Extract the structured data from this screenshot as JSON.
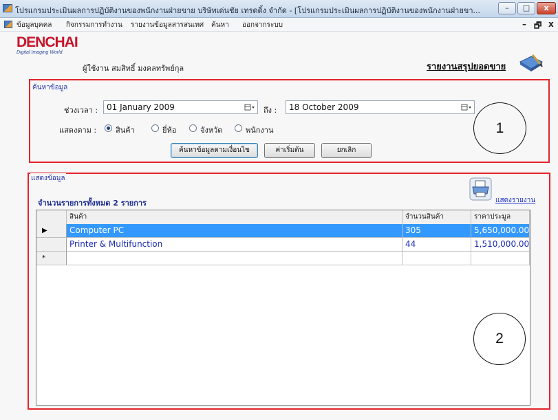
{
  "window": {
    "title": "โปรแกรมประเมินผลการปฏิบัติงานของพนักงานฝ่ายขาย บริษัทเด่นชัย เทรดดิ้ง จำกัด - [โปรแกรมประเมินผลการปฏิบัติงานของพนักงานฝ่ายขา...",
    "minimize_label": "–",
    "maximize_label": "□",
    "close_label": "x"
  },
  "menu": {
    "items": [
      "ข้อมูลบุคคล",
      "กิจกรรมการทำงาน",
      "รายงานข้อมูลสารสนเทศ",
      "ค้นหา",
      "ออกจากระบบ"
    ],
    "mdi_min": "–",
    "mdi_restore": "🗗",
    "mdi_close": "x"
  },
  "header": {
    "logo_main": "DENCHAI",
    "logo_sub": "Digital Imaging World",
    "user_label": "ผู้ใช้งาน",
    "user_name": "สมสิทธิ์ มงคลทรัพย์กุล",
    "report_title": "รายงานสรุปยอดขาย"
  },
  "search": {
    "legend": "ค้นหาข้อมูล",
    "period_label": "ช่วงเวลา :",
    "date_from": "01  January  2009",
    "to_label": "ถึง :",
    "date_to": "18  October  2009",
    "show_by_label": "แสดงตาม :",
    "radios": [
      {
        "label": "สินค้า",
        "checked": true
      },
      {
        "label": "ยี่ห้อ",
        "checked": false
      },
      {
        "label": "จังหวัด",
        "checked": false
      },
      {
        "label": "พนักงาน",
        "checked": false
      }
    ],
    "search_button": "ค้นหาข้อมูลตามเงื่อนไข",
    "reset_button": "ค่าเริ่มต้น",
    "cancel_button": "ยกเลิก"
  },
  "display": {
    "legend": "แสดงข้อมูล",
    "count_label": "จำนวนรายการทั้งหมด  2  รายการ",
    "print_label": "แสดงรายงาน",
    "columns": [
      "สินค้า",
      "จำนวนสินค้า",
      "ราคาประมูล"
    ],
    "rows": [
      {
        "indicator": "▶",
        "product": "Computer PC",
        "qty": "305",
        "price": "5,650,000.00"
      },
      {
        "indicator": "",
        "product": "Printer & Multifunction",
        "qty": "44",
        "price": "1,510,000.00"
      }
    ],
    "new_row_indicator": "*"
  },
  "annotations": {
    "circle_1": "1",
    "circle_2": "2"
  },
  "colors": {
    "highlight_border": "#e3242b",
    "selection": "#3399ff",
    "logo_red": "#c8142a"
  }
}
